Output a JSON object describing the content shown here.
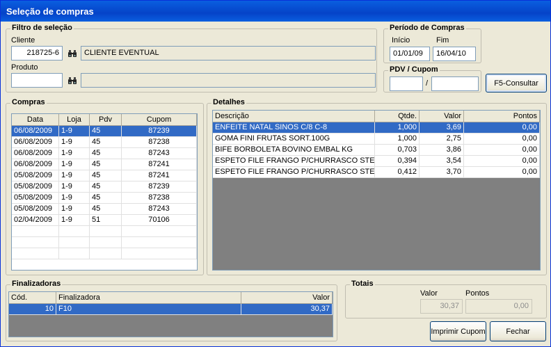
{
  "window": {
    "title": "Seleção de compras"
  },
  "filter": {
    "legend": "Filtro de seleção",
    "cliente_label": "Cliente",
    "cliente_code": "218725-6",
    "cliente_name": "CLIENTE EVENTUAL",
    "produto_label": "Produto",
    "produto_code": "",
    "produto_name": ""
  },
  "period": {
    "legend": "Período de Compras",
    "inicio_label": "Início",
    "fim_label": "Fim",
    "inicio": "01/01/09",
    "fim": "16/04/10"
  },
  "pdv_cupom": {
    "legend": "PDV / Cupom",
    "pdv": "",
    "separator": "/",
    "cupom": ""
  },
  "consultar_button": "F5-Consultar",
  "compras": {
    "legend": "Compras",
    "columns": [
      "Data",
      "Loja",
      "Pdv",
      "Cupom"
    ],
    "rows": [
      {
        "data": "06/08/2009",
        "loja": "1-9",
        "pdv": "45",
        "cupom": "87239"
      },
      {
        "data": "06/08/2009",
        "loja": "1-9",
        "pdv": "45",
        "cupom": "87238"
      },
      {
        "data": "06/08/2009",
        "loja": "1-9",
        "pdv": "45",
        "cupom": "87243"
      },
      {
        "data": "06/08/2009",
        "loja": "1-9",
        "pdv": "45",
        "cupom": "87241"
      },
      {
        "data": "05/08/2009",
        "loja": "1-9",
        "pdv": "45",
        "cupom": "87241"
      },
      {
        "data": "05/08/2009",
        "loja": "1-9",
        "pdv": "45",
        "cupom": "87239"
      },
      {
        "data": "05/08/2009",
        "loja": "1-9",
        "pdv": "45",
        "cupom": "87238"
      },
      {
        "data": "05/08/2009",
        "loja": "1-9",
        "pdv": "45",
        "cupom": "87243"
      },
      {
        "data": "02/04/2009",
        "loja": "1-9",
        "pdv": "51",
        "cupom": "70106"
      }
    ]
  },
  "detalhes": {
    "legend": "Detalhes",
    "columns": [
      "Descrição",
      "Qtde.",
      "Valor",
      "Pontos"
    ],
    "rows": [
      {
        "descricao": "ENFEITE NATAL SINOS C/8 C-8",
        "qtde": "1,000",
        "valor": "3,69",
        "pontos": "0,00"
      },
      {
        "descricao": "GOMA FINI FRUTAS SORT.100G",
        "qtde": "1,000",
        "valor": "2,75",
        "pontos": "0,00"
      },
      {
        "descricao": "BIFE BORBOLETA BOVINO EMBAL KG",
        "qtde": "0,703",
        "valor": "3,86",
        "pontos": "0,00"
      },
      {
        "descricao": "ESPETO FILE FRANGO P/CHURRASCO STEF",
        "qtde": "0,394",
        "valor": "3,54",
        "pontos": "0,00"
      },
      {
        "descricao": "ESPETO FILE FRANGO P/CHURRASCO STEF",
        "qtde": "0,412",
        "valor": "3,70",
        "pontos": "0,00"
      }
    ]
  },
  "finalizadoras": {
    "legend": "Finalizadoras",
    "columns": [
      "Cód.",
      "Finalizadora",
      "Valor"
    ],
    "rows": [
      {
        "cod": "10",
        "finalizadora": "F10",
        "valor": "30,37"
      }
    ]
  },
  "totais": {
    "legend": "Totais",
    "valor_label": "Valor",
    "pontos_label": "Pontos",
    "valor": "30,37",
    "pontos": "0,00"
  },
  "buttons": {
    "imprimir": "Imprimir Cupom",
    "fechar": "Fechar"
  },
  "icons": {
    "search": "binoculars-icon"
  },
  "colors": {
    "selection": "#316ac5",
    "titlebar": "#0a5fe0",
    "face": "#ece9d8"
  }
}
